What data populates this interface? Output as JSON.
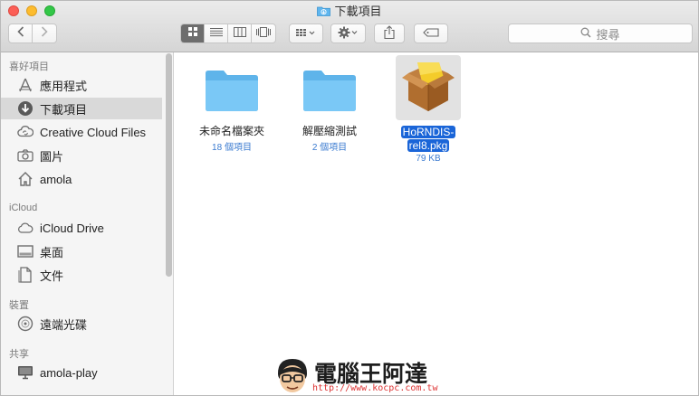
{
  "window": {
    "title": "下載項目"
  },
  "toolbar": {
    "search_placeholder": "搜尋",
    "view_modes": [
      "icon",
      "list",
      "column",
      "cover-flow"
    ],
    "active_view": "icon"
  },
  "sidebar": {
    "sections": [
      {
        "heading": "喜好項目",
        "items": [
          {
            "label": "應用程式",
            "icon": "applications-icon"
          },
          {
            "label": "下載項目",
            "icon": "downloads-icon",
            "selected": true
          },
          {
            "label": "Creative Cloud Files",
            "icon": "creative-cloud-icon"
          },
          {
            "label": "圖片",
            "icon": "camera-icon"
          },
          {
            "label": "amola",
            "icon": "home-icon"
          }
        ]
      },
      {
        "heading": "iCloud",
        "items": [
          {
            "label": "iCloud Drive",
            "icon": "cloud-icon"
          },
          {
            "label": "桌面",
            "icon": "desktop-icon"
          },
          {
            "label": "文件",
            "icon": "document-icon"
          }
        ]
      },
      {
        "heading": "裝置",
        "items": [
          {
            "label": "遠端光碟",
            "icon": "disc-icon"
          }
        ]
      },
      {
        "heading": "共享",
        "items": [
          {
            "label": "amola-play",
            "icon": "computer-icon"
          }
        ]
      }
    ]
  },
  "files": [
    {
      "name": "未命名檔案夾",
      "meta": "18 個項目",
      "kind": "folder"
    },
    {
      "name": "解壓縮測試",
      "meta": "2 個項目",
      "kind": "folder"
    },
    {
      "name_line1": "HoRNDIS-",
      "name_line2": "rel8.pkg",
      "meta": "79 KB",
      "kind": "package",
      "selected": true
    }
  ],
  "watermark": {
    "brand": "電腦王阿達",
    "url": "http://www.kocpc.com.tw"
  },
  "colors": {
    "selection": "#1a65d8",
    "folder": "#6cc0f4",
    "meta_text": "#3b7bd0"
  }
}
